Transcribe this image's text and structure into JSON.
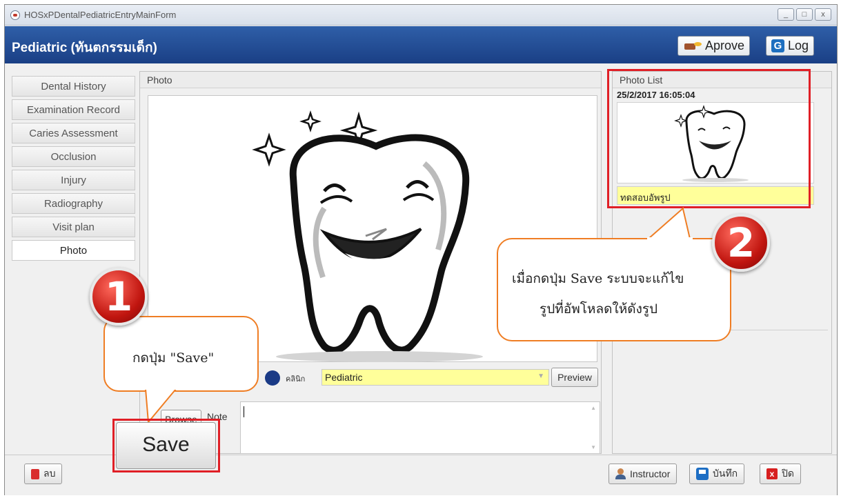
{
  "window": {
    "title": "HOSxPDentalPediatricEntryMainForm",
    "controls": [
      "_",
      "□",
      "x"
    ]
  },
  "header": {
    "title": "Pediatric (ทันตกรรมเด็ก)",
    "approve_label": "Aprove",
    "log_label": "Log",
    "log_icon_glyph": "G"
  },
  "nav": {
    "items": [
      {
        "label": "Dental History"
      },
      {
        "label": "Examination Record"
      },
      {
        "label": "Caries Assessment"
      },
      {
        "label": "Occlusion"
      },
      {
        "label": "Injury"
      },
      {
        "label": "Radiography"
      },
      {
        "label": "Visit plan"
      },
      {
        "label": "Photo"
      }
    ],
    "active": "Photo"
  },
  "photo_panel": {
    "title": "Photo",
    "clinic_label": "คลินิก",
    "clinic_value": "Pediatric",
    "preview_label": "Preview",
    "browse_label": "Browse",
    "note_label": "Note",
    "note_value": ""
  },
  "photo_list": {
    "title": "Photo List",
    "entries": [
      {
        "datetime": "25/2/2017 16:05:04",
        "caption": "ทดสอบอัพรูป"
      }
    ]
  },
  "save_button_label": "Save",
  "bottom": {
    "delete_label": "ลบ",
    "instructor_label": "Instructor",
    "save_label": "บันทึก",
    "close_label": "ปิด"
  },
  "annotations": {
    "badge1": "1",
    "badge2": "2",
    "callout1": "กดปุ่ม \"Save\"",
    "callout2_line1": "เมื่อกดปุ่ม Save ระบบจะแก้ไข",
    "callout2_line2": "รูปที่อัพโหลดให้ดังรูป",
    "frame_color": "#e01f26",
    "callout_border_color": "#ef7d23"
  },
  "colors": {
    "header_bg": "#1f4a93",
    "highlight_yellow": "#ffff9a"
  }
}
